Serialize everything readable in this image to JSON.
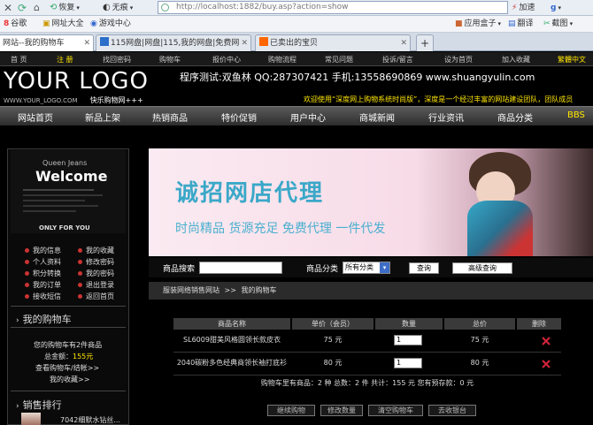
{
  "browser": {
    "back_label": "恢复",
    "nodisplay_label": "无痕",
    "address": "http://localhost:1882/buy.asp?action=show",
    "speed_label": "加速",
    "bookmarks": [
      "谷歌",
      "网址大全",
      "游戏中心"
    ],
    "right_bookmarks": [
      "应用盒子",
      "翻译",
      "截图"
    ],
    "tabs": [
      "网站--我的购物车",
      "115网盘|网盘|115,我的网盘|免费网...",
      "已卖出的宝贝"
    ]
  },
  "topnav": [
    "首 页",
    "注 册",
    "找回密码",
    "购物车",
    "报价中心",
    "购物流程",
    "常见问题",
    "投诉/留言",
    "设为首页",
    "加入收藏",
    "繁體中文"
  ],
  "logo": {
    "text": "YOUR LOGO",
    "sub": "WWW.YOUR_LOGO.COM",
    "slogan": "快乐购物网+++"
  },
  "contact": "程序测试:双鱼林 QQ:287307421 手机:13558690869 www.shuangyulin.com",
  "marquee": "欢迎使用“深度网上购物系统时尚版”，深度是一个经过丰富的网站建设团队，团队成员",
  "mainnav": [
    "网站首页",
    "新品上架",
    "热销商品",
    "特价促销",
    "用户中心",
    "商城新闻",
    "行业资讯",
    "商品分类",
    "BBS"
  ],
  "welcome": {
    "brand": "Queen Jeans",
    "title": "Welcome",
    "footer": "ONLY FOR YOU"
  },
  "usermenu": [
    [
      "我的信息",
      "我的收藏"
    ],
    [
      "个人资料",
      "修改密码"
    ],
    [
      "积分转换",
      "我的密码"
    ],
    [
      "我的订单",
      "退出登录"
    ],
    [
      "接收短信",
      "返回首页"
    ]
  ],
  "mycart": {
    "title": "我的购物车",
    "count_text": "您的购物车有2件商品",
    "total_label": "总金额：",
    "total_value": "155元",
    "view_link": "查看购物车/结帐>>",
    "fav_link": "我的收藏>>"
  },
  "sales": {
    "title": "销售排行",
    "first_item": "7042细默水钻丝..."
  },
  "banner": {
    "headline": "诚招网店代理",
    "tagline": "时尚精品  货源充足  免费代理  一件代发"
  },
  "search": {
    "label": "商品搜索",
    "category_label": "商品分类",
    "category_value": "所有分类",
    "query_btn": "查询",
    "advanced_btn": "高级查询"
  },
  "breadcrumb": {
    "root": "服装网络销售网站",
    "sep": ">>",
    "current": "我的购物车"
  },
  "cart_table": {
    "headers": [
      "商品名称",
      "单价（会员）",
      "数量",
      "总价",
      "删除"
    ],
    "rows": [
      {
        "name": "SL6009甜美风格圆领长款皮衣",
        "price": "75 元",
        "qty": "1",
        "total": "75 元"
      },
      {
        "name": "2040碳粉多色经典商领长袖打底衫",
        "price": "80 元",
        "qty": "1",
        "total": "80 元"
      }
    ],
    "summary": "购物车里有商品：2 种  总数：2 件  共计：155 元  您有预存款：0 元"
  },
  "actions": [
    "继续购物",
    "修改数量",
    "清空购物车",
    "去收银台"
  ],
  "colors": {
    "accent": "#ffe600",
    "banner_text": "#3aa8c8",
    "delete": "#d0233a"
  }
}
